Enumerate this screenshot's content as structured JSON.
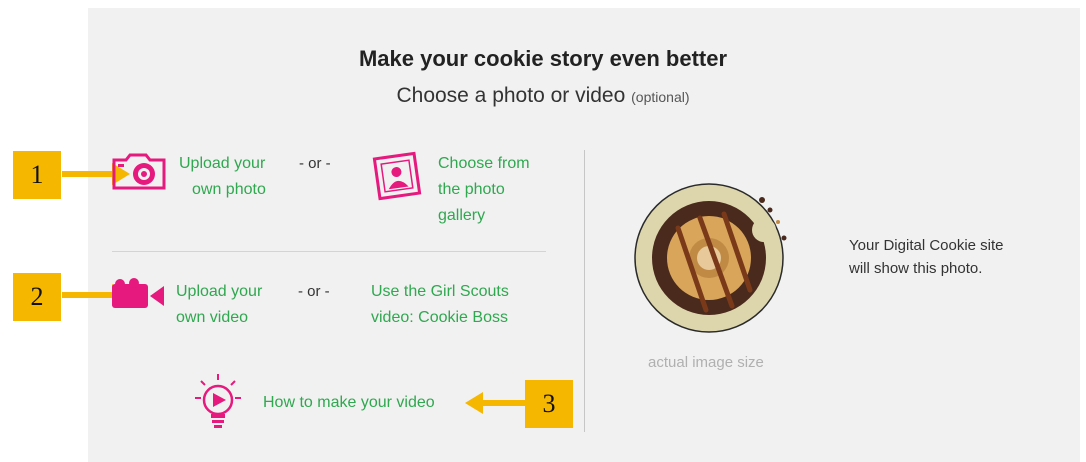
{
  "header": {
    "title": "Make your cookie story even better",
    "subtitle": "Choose a photo or video",
    "optional": "(optional)"
  },
  "photo": {
    "upload_line1": "Upload your",
    "upload_line2": "own photo",
    "or": "- or -",
    "gallery_line1": "Choose from",
    "gallery_line2": "the photo",
    "gallery_line3": "gallery"
  },
  "video": {
    "upload_line1": "Upload your",
    "upload_line2": "own video",
    "or": "- or -",
    "gs_line1": "Use the Girl Scouts",
    "gs_line2": "video: Cookie Boss"
  },
  "howto": {
    "label": "How to make your video"
  },
  "preview": {
    "description_line1": "Your Digital Cookie site",
    "description_line2": "will show this photo.",
    "size_label": "actual image size"
  },
  "callouts": [
    "1",
    "2",
    "3"
  ],
  "colors": {
    "link": "#2fa84f",
    "icon_pink": "#e5197e",
    "callout": "#f5b700",
    "panel": "#f1f1f1"
  },
  "icons": {
    "camera": "camera-icon",
    "picture": "picture-icon",
    "video_camera": "video-camera-icon",
    "lightbulb": "lightbulb-play-icon",
    "arrow": "arrow-icon"
  }
}
